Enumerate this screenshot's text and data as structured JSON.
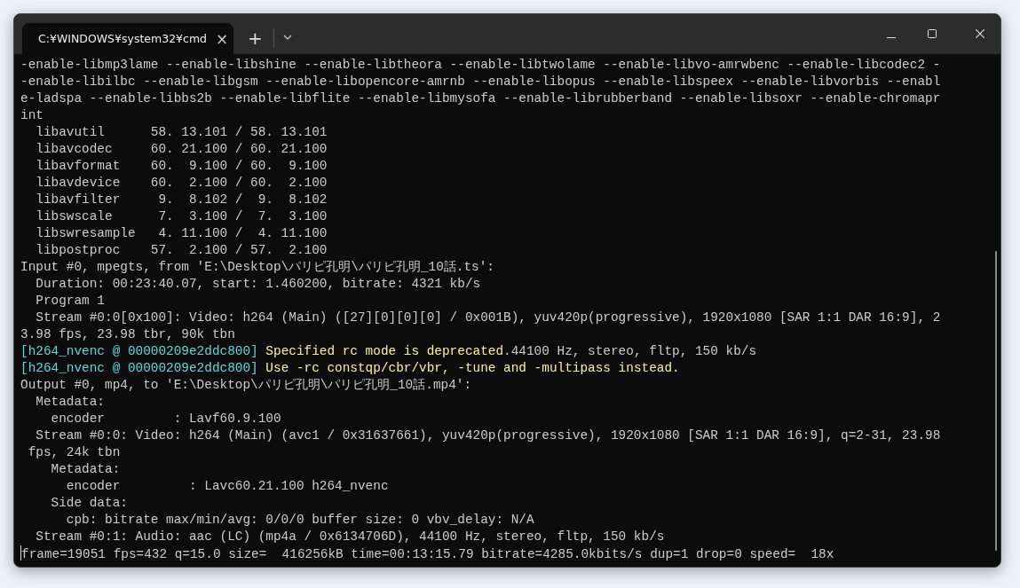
{
  "tabs": [
    {
      "title": "C:¥WINDOWS¥system32¥cmd",
      "close": "×",
      "selected": true
    }
  ],
  "new_tab": "+",
  "console": {
    "lines": [
      [
        {
          "kind": "normal",
          "text": "-enable-libmp3lame --enable-libshine --enable-libtheora --enable-libtwolame --enable-libvo-amrwbenc --enable-libcodec2 -"
        }
      ],
      [
        {
          "kind": "normal",
          "text": "-enable-libilbc --enable-libgsm --enable-libopencore-amrnb --enable-libopus --enable-libspeex --enable-libvorbis --enabl"
        }
      ],
      [
        {
          "kind": "normal",
          "text": "e-ladspa --enable-libbs2b --enable-libflite --enable-libmysofa --enable-librubberband --enable-libsoxr --enable-chromapr"
        }
      ],
      [
        {
          "kind": "normal",
          "text": "int"
        }
      ],
      [
        {
          "kind": "normal",
          "text": "  libavutil      58. 13.101 / 58. 13.101"
        }
      ],
      [
        {
          "kind": "normal",
          "text": "  libavcodec     60. 21.100 / 60. 21.100"
        }
      ],
      [
        {
          "kind": "normal",
          "text": "  libavformat    60.  9.100 / 60.  9.100"
        }
      ],
      [
        {
          "kind": "normal",
          "text": "  libavdevice    60.  2.100 / 60.  2.100"
        }
      ],
      [
        {
          "kind": "normal",
          "text": "  libavfilter     9.  8.102 /  9.  8.102"
        }
      ],
      [
        {
          "kind": "normal",
          "text": "  libswscale      7.  3.100 /  7.  3.100"
        }
      ],
      [
        {
          "kind": "normal",
          "text": "  libswresample   4. 11.100 /  4. 11.100"
        }
      ],
      [
        {
          "kind": "normal",
          "text": "  libpostproc    57.  2.100 / 57.  2.100"
        }
      ],
      [
        {
          "kind": "normal",
          "text": "Input #0, mpegts, from 'E:\\Desktop\\パリピ孔明\\パリピ孔明_10話.ts':"
        }
      ],
      [
        {
          "kind": "normal",
          "text": "  Duration: 00:23:40.07, start: 1.460200, bitrate: 4321 kb/s"
        }
      ],
      [
        {
          "kind": "normal",
          "text": "  Program 1"
        }
      ],
      [
        {
          "kind": "normal",
          "text": "  Stream #0:0[0x100]: Video: h264 (Main) ([27][0][0][0] / 0x001B), yuv420p(progressive), 1920x1080 [SAR 1:1 DAR 16:9], 2"
        }
      ],
      [
        {
          "kind": "normal",
          "text": "3.98 fps, 23.98 tbr, 90k tbn"
        }
      ],
      [
        {
          "kind": "prefix",
          "text": "[h264_nvenc @ 00000209e2ddc800] "
        },
        {
          "kind": "warning",
          "text": "Specified rc mode is deprecated"
        },
        {
          "kind": "normal",
          "text": ".44100 Hz, stereo, fltp, 150 kb/s"
        }
      ],
      [
        {
          "kind": "prefix",
          "text": "[h264_nvenc @ 00000209e2ddc800] "
        },
        {
          "kind": "warning",
          "text": "Use -rc constqp/cbr/vbr, -tune and -multipass instead."
        }
      ],
      [
        {
          "kind": "normal",
          "text": "Output #0, mp4, to 'E:\\Desktop\\パリピ孔明\\パリピ孔明_10話.mp4':"
        }
      ],
      [
        {
          "kind": "normal",
          "text": "  Metadata:"
        }
      ],
      [
        {
          "kind": "normal",
          "text": "    encoder         : Lavf60.9.100"
        }
      ],
      [
        {
          "kind": "normal",
          "text": "  Stream #0:0: Video: h264 (Main) (avc1 / 0x31637661), yuv420p(progressive), 1920x1080 [SAR 1:1 DAR 16:9], q=2-31, 23.98"
        }
      ],
      [
        {
          "kind": "normal",
          "text": " fps, 24k tbn"
        }
      ],
      [
        {
          "kind": "normal",
          "text": "    Metadata:"
        }
      ],
      [
        {
          "kind": "normal",
          "text": "      encoder         : Lavc60.21.100 h264_nvenc"
        }
      ],
      [
        {
          "kind": "normal",
          "text": "    Side data:"
        }
      ],
      [
        {
          "kind": "normal",
          "text": "      cpb: bitrate max/min/avg: 0/0/0 buffer size: 0 vbv_delay: N/A"
        }
      ],
      [
        {
          "kind": "normal",
          "text": "  Stream #0:1: Audio: aac (LC) (mp4a / 0x6134706D), 44100 Hz, stereo, fltp, 150 kb/s"
        }
      ],
      [
        {
          "kind": "cursor"
        },
        {
          "kind": "normal",
          "text": "frame=19051 fps=432 q=15.0 size=  416256kB time=00:13:15.79 bitrate=4285.0kbits/s dup=1 drop=0 speed=  18x"
        }
      ]
    ]
  }
}
